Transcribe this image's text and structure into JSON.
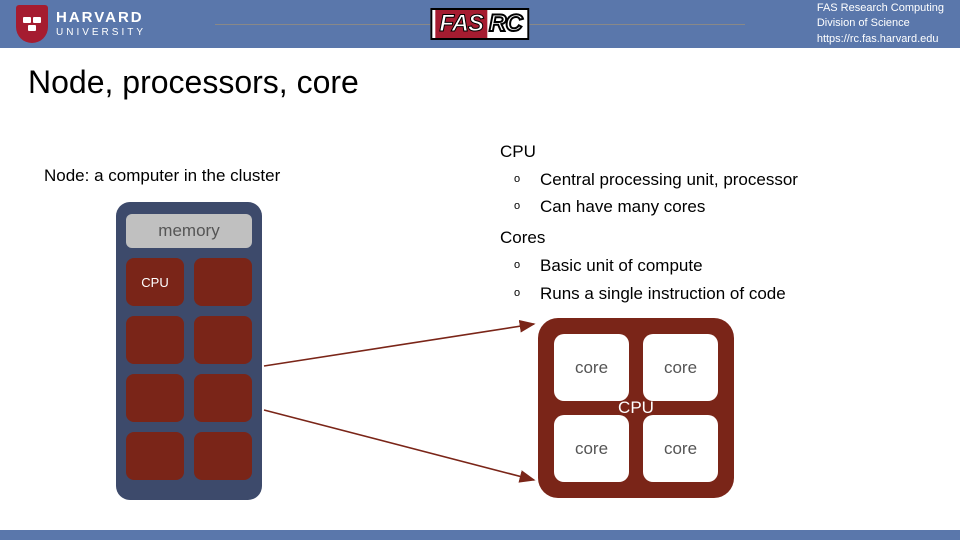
{
  "header": {
    "harvard_name": "HARVARD",
    "harvard_sub": "UNIVERSITY",
    "fasrc_fas": "FAS",
    "fasrc_rc": "RC",
    "right_line1": "FAS Research Computing",
    "right_line2": "Division of Science",
    "right_line3": "https://rc.fas.harvard.edu"
  },
  "title": "Node, processors, core",
  "node": {
    "label": "Node: a computer in the cluster",
    "memory": "memory",
    "cpu_chip": "CPU"
  },
  "cpu_block": {
    "label": "CPU",
    "core": "core"
  },
  "bullets": {
    "cpu_hdr": "CPU",
    "cpu_items": [
      "Central processing unit, processor",
      "Can have many cores"
    ],
    "cores_hdr": "Cores",
    "cores_items": [
      "Basic unit of compute",
      "Runs a single instruction of code"
    ]
  }
}
